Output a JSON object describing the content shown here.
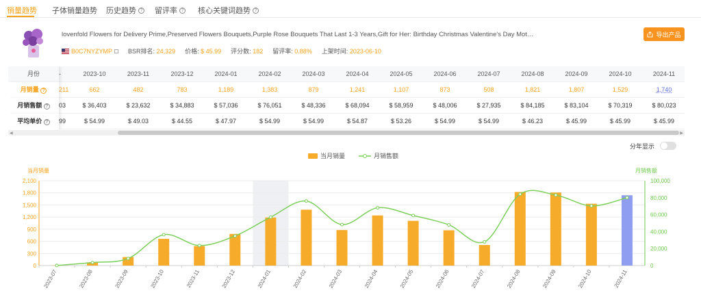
{
  "tabs": [
    {
      "label": "销量趋势",
      "active": true,
      "help": false
    },
    {
      "label": "子体销量趋势",
      "active": false,
      "help": false
    },
    {
      "label": "历史趋势",
      "active": false,
      "help": true
    },
    {
      "label": "留评率",
      "active": false,
      "help": true
    },
    {
      "label": "核心关键词趋势",
      "active": false,
      "help": true
    }
  ],
  "product": {
    "title": "lovenfold Flowers for Delivery Prime,Preserved Flowers Bouquets,Purple Rose Bouquets That Last 1-3 Years,Gift for Her: Birthday Christmas Valentine's Day Mothe...",
    "asin": "B0C7NYZYMP",
    "bsr_label": "BSR排名:",
    "bsr_value": "24,329",
    "price_label": "价格:",
    "price_value": "$ 45.99",
    "reviews_label": "评分数:",
    "reviews_value": "182",
    "review_rate_label": "留评率:",
    "review_rate_value": "0.88%",
    "launch_label": "上架时间:",
    "launch_value": "2023-06-10",
    "export_label": "导出产品"
  },
  "table": {
    "row_labels": {
      "month": "月份",
      "sales": "月销量",
      "revenue": "月销售额",
      "avg_price": "平均单价"
    },
    "partial_col": {
      "sales": "211",
      "revenue": "03",
      "avg_price": "99"
    },
    "months": [
      "2023-10",
      "2023-11",
      "2023-12",
      "2024-01",
      "2024-02",
      "2024-03",
      "2024-04",
      "2024-05",
      "2024-06",
      "2024-07",
      "2024-08",
      "2024-09",
      "2024-10",
      "2024-11"
    ],
    "sales": [
      "662",
      "482",
      "783",
      "1,189",
      "1,383",
      "879",
      "1,241",
      "1,107",
      "873",
      "508",
      "1,821",
      "1,807",
      "1,529",
      "1,740"
    ],
    "revenue": [
      "$ 36,403",
      "$ 23,632",
      "$ 34,883",
      "$ 57,036",
      "$ 76,051",
      "$ 48,336",
      "$ 68,094",
      "$ 58,959",
      "$ 48,006",
      "$ 27,935",
      "$ 84,185",
      "$ 83,104",
      "$ 70,319",
      "$ 80,023"
    ],
    "avg_price": [
      "$ 54.99",
      "$ 49.03",
      "$ 44.55",
      "$ 47.97",
      "$ 54.99",
      "$ 54.99",
      "$ 54.87",
      "$ 53.26",
      "$ 54.99",
      "$ 54.99",
      "$ 46.23",
      "$ 45.99",
      "$ 45.99",
      "$ 45.99"
    ]
  },
  "toggle_label": "分年显示",
  "colors": {
    "bar": "#f7ab2a",
    "bar_current": "#8f9ef0",
    "line": "#7dcf5a",
    "accent": "#f7931e"
  },
  "chart_data": {
    "type": "bar",
    "legend": [
      "当月销量",
      "月销售额"
    ],
    "ylabel_left": "当月销量",
    "ylabel_right": "月销售额",
    "ylim_left": [
      0,
      2100
    ],
    "yticks_left": [
      "0",
      "300",
      "600",
      "900",
      "1,200",
      "1,500",
      "1,800",
      "2,100"
    ],
    "ylim_right": [
      0,
      100000
    ],
    "yticks_right": [
      "0",
      "20,000",
      "40,000",
      "60,000",
      "80,000",
      "100,000"
    ],
    "categories": [
      "2023-07",
      "2023-08",
      "2023-09",
      "2023-10",
      "2023-11",
      "2023-12",
      "2024-01",
      "2024-02",
      "2024-03",
      "2024-04",
      "2024-05",
      "2024-06",
      "2024-07",
      "2024-08",
      "2024-09",
      "2024-10",
      "2024-11"
    ],
    "series": [
      {
        "name": "当月销量",
        "kind": "bar",
        "values": [
          5,
          80,
          211,
          662,
          482,
          783,
          1189,
          1383,
          879,
          1241,
          1107,
          873,
          508,
          1821,
          1807,
          1529,
          1740
        ]
      },
      {
        "name": "月销售额",
        "kind": "line",
        "values": [
          150,
          3500,
          8300,
          36403,
          23632,
          34883,
          57036,
          76051,
          48336,
          68094,
          58959,
          48006,
          27935,
          84185,
          83104,
          70319,
          80023
        ]
      }
    ],
    "highlight_category": "2024-01",
    "grid": true
  }
}
